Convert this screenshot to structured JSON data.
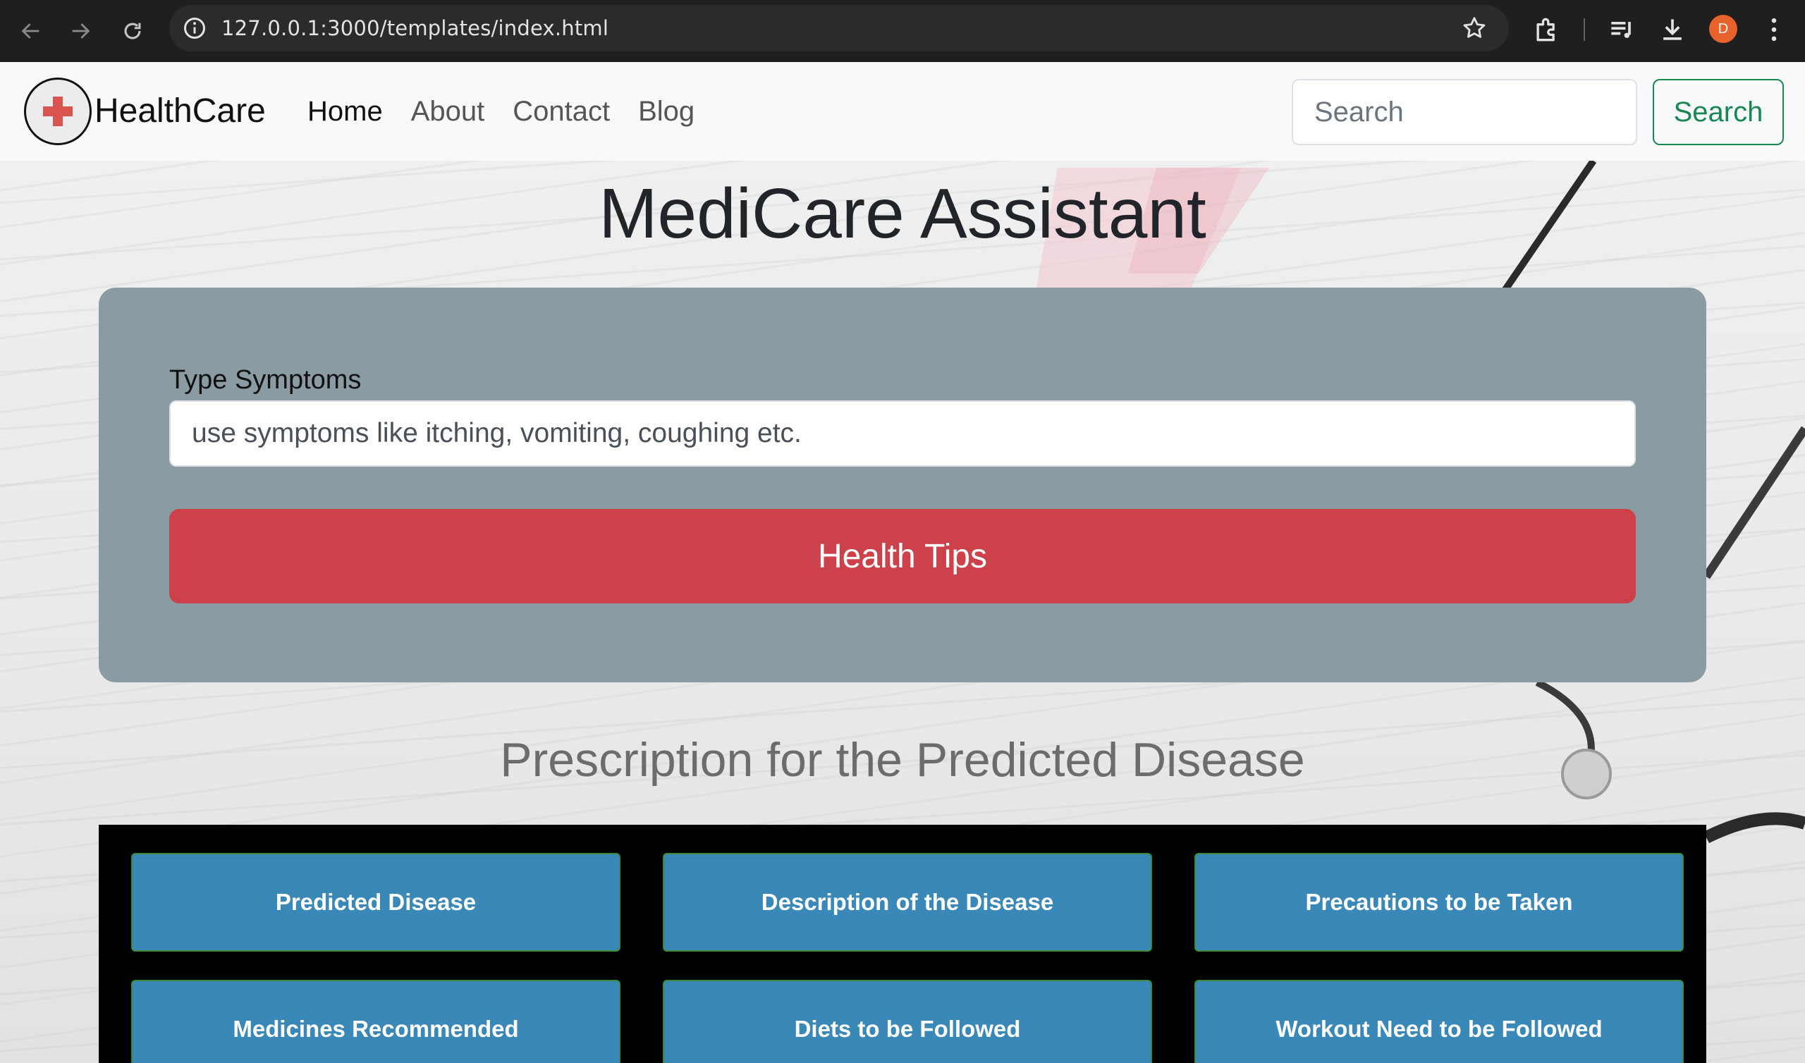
{
  "browser": {
    "url": "127.0.0.1:3000/templates/index.html",
    "profile_initial": "D"
  },
  "navbar": {
    "brand": "HealthCare",
    "links": [
      {
        "label": "Home"
      },
      {
        "label": "About"
      },
      {
        "label": "Contact"
      },
      {
        "label": "Blog"
      }
    ],
    "search_placeholder": "Search",
    "search_button": "Search"
  },
  "main": {
    "title": "MediCare Assistant",
    "form": {
      "label": "Type Symptoms",
      "input_value": "",
      "input_placeholder": "use symptoms like itching, vomiting, coughing etc.",
      "submit_label": "Health Tips"
    },
    "section_title": "Prescription for the Predicted Disease",
    "result_buttons": [
      {
        "label": "Predicted Disease"
      },
      {
        "label": "Description of the Disease"
      },
      {
        "label": "Precautions to be Taken"
      },
      {
        "label": "Medicines Recommended"
      },
      {
        "label": "Diets to be Followed"
      },
      {
        "label": "Workout Need to be Followed"
      }
    ]
  },
  "colors": {
    "form_card": "#8a9ca1",
    "primary_red": "#cc414a",
    "result_button": "#3a88b7",
    "success_green": "#198754"
  }
}
